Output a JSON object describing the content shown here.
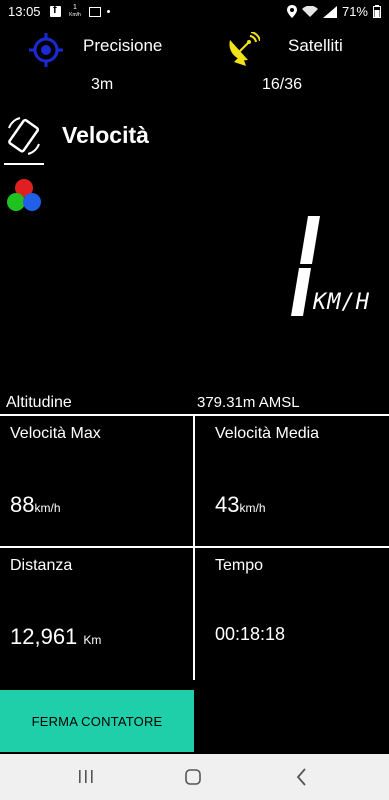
{
  "statusbar": {
    "time": "13:05",
    "mini_speed": "1",
    "mini_unit": "Km/h",
    "battery": "71%"
  },
  "header": {
    "precision_label": "Precisione",
    "precision_value": "3m",
    "satellites_label": "Satelliti",
    "satellites_value": "16/36"
  },
  "speed": {
    "title": "Velocità",
    "value": "1",
    "unit": "KM/H"
  },
  "altitude": {
    "label": "Altitudine",
    "value": "379.31m AMSL"
  },
  "stats": {
    "max_label": "Velocità Max",
    "max_value": "88",
    "max_unit": "km/h",
    "avg_label": "Velocità Media",
    "avg_value": "43",
    "avg_unit": "km/h",
    "distance_label": "Distanza",
    "distance_value": "12,961",
    "distance_unit": "Km",
    "time_label": "Tempo",
    "time_value": "00:18:18"
  },
  "actions": {
    "stop_label": "FERMA CONTATORE"
  },
  "colors": {
    "accent": "#1fcfa9",
    "precision_icon": "#1a2bd6",
    "satellite_icon": "#f2e21a"
  }
}
